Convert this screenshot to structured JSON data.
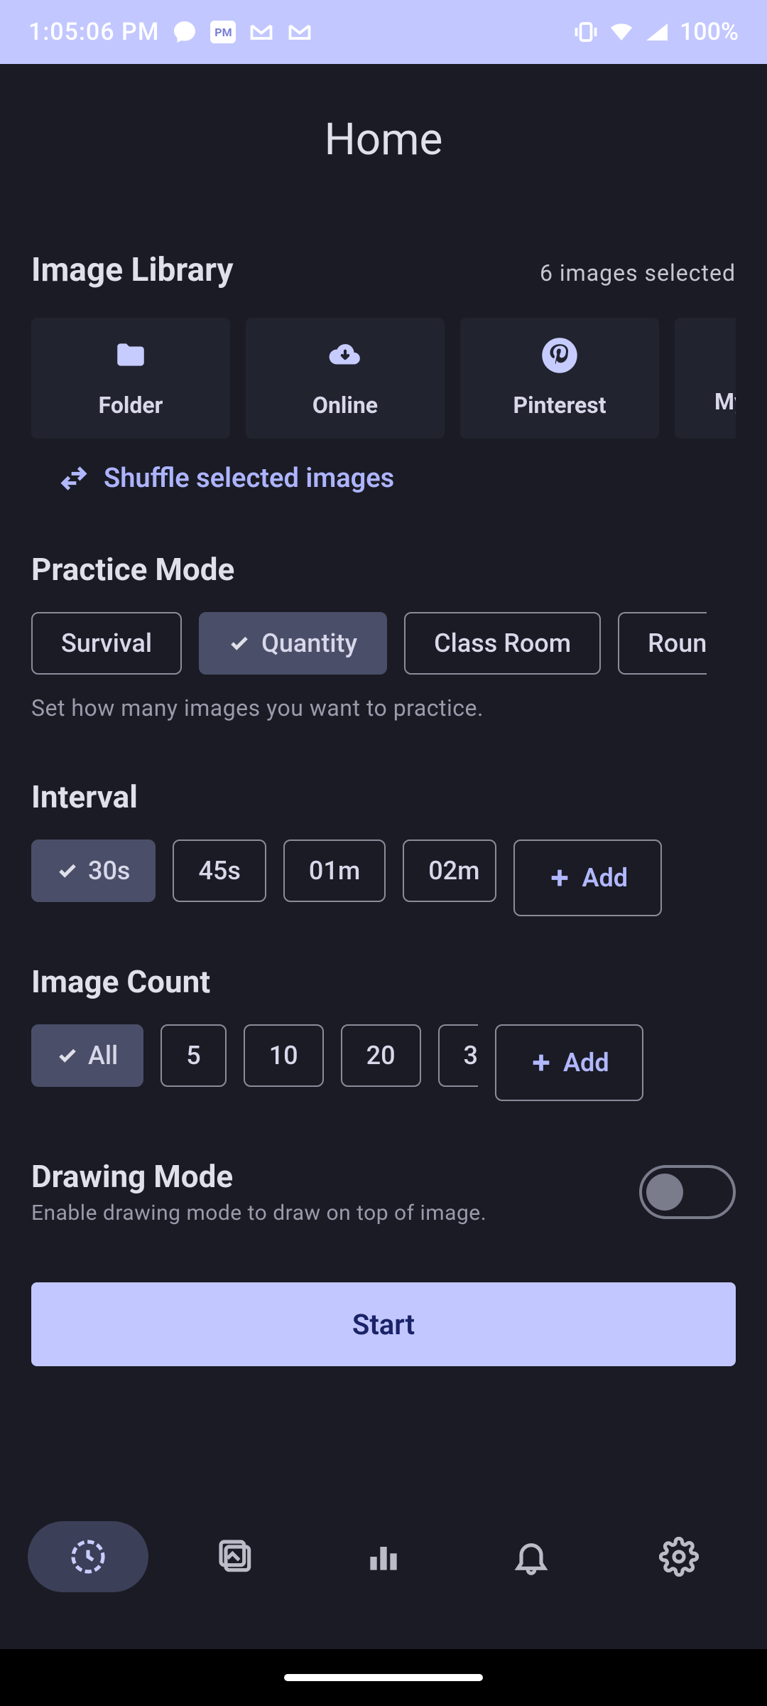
{
  "status_bar": {
    "time": "1:05:06 PM",
    "battery": "100%"
  },
  "header": {
    "title": "Home"
  },
  "library": {
    "title": "Image Library",
    "selected_text": "6 images selected",
    "cards": [
      {
        "label": "Folder"
      },
      {
        "label": "Online"
      },
      {
        "label": "Pinterest"
      },
      {
        "label": "My"
      }
    ],
    "shuffle_label": "Shuffle selected images"
  },
  "practice_mode": {
    "title": "Practice Mode",
    "options": [
      "Survival",
      "Quantity",
      "Class Room",
      "Roun"
    ],
    "selected_index": 1,
    "description": "Set how many images you want to practice."
  },
  "interval": {
    "title": "Interval",
    "options": [
      "30s",
      "45s",
      "01m",
      "02m"
    ],
    "selected_index": 0,
    "add_label": "Add"
  },
  "image_count": {
    "title": "Image Count",
    "options": [
      "All",
      "5",
      "10",
      "20",
      "3"
    ],
    "selected_index": 0,
    "add_label": "Add"
  },
  "drawing_mode": {
    "title": "Drawing Mode",
    "description": "Enable drawing mode to draw on top of image.",
    "enabled": false
  },
  "start_button": {
    "label": "Start"
  }
}
